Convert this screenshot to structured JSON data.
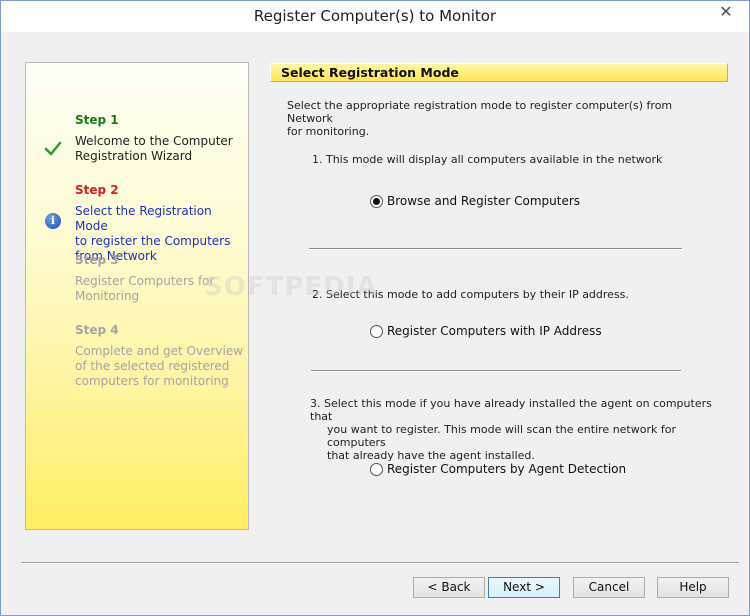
{
  "window": {
    "title": "Register Computer(s) to Monitor",
    "close_glyph": "✕"
  },
  "steps": [
    {
      "title": "Step 1",
      "desc_lines": [
        "Welcome to the Computer",
        "Registration Wizard"
      ],
      "icon": "check-icon"
    },
    {
      "title": "Step 2",
      "desc_lines": [
        "Select the Registration Mode",
        "to register the Computers",
        "from Network"
      ],
      "icon": "info-icon"
    },
    {
      "title": "Step 3",
      "desc_lines": [
        "Register Computers for",
        "Monitoring"
      ]
    },
    {
      "title": "Step 4",
      "desc_lines": [
        "Complete and get Overview",
        "of the selected registered",
        "computers for monitoring"
      ]
    }
  ],
  "header": {
    "label": "Select Registration Mode"
  },
  "intro": {
    "lines": [
      "Select the appropriate registration mode to register computer(s) from Network",
      "for monitoring."
    ]
  },
  "modes": [
    {
      "desc_lines": [
        "1.  This mode will display all computers available in the  network"
      ],
      "option": "Browse and Register Computers",
      "selected": true
    },
    {
      "desc_lines": [
        "2.  Select this mode to add computers by their IP address."
      ],
      "option": "Register Computers with IP Address",
      "selected": false
    },
    {
      "desc_lines": [
        "3.  Select this mode if you have already installed the agent on computers that",
        "you want to register. This mode will scan the entire network for computers",
        "that already have the agent installed."
      ],
      "option": "Register Computers by Agent Detection",
      "selected": false
    }
  ],
  "buttons": {
    "back": "< Back",
    "next": "Next >",
    "cancel": "Cancel",
    "help": "Help"
  },
  "watermark": "SOFTPEDIA",
  "colors": {
    "accent_yellow": "#ffe55a",
    "step_done": "#1a7a1a",
    "step_current": "#d42020",
    "step_current_desc": "#1a33b8",
    "step_pending": "#a4a4a4"
  }
}
